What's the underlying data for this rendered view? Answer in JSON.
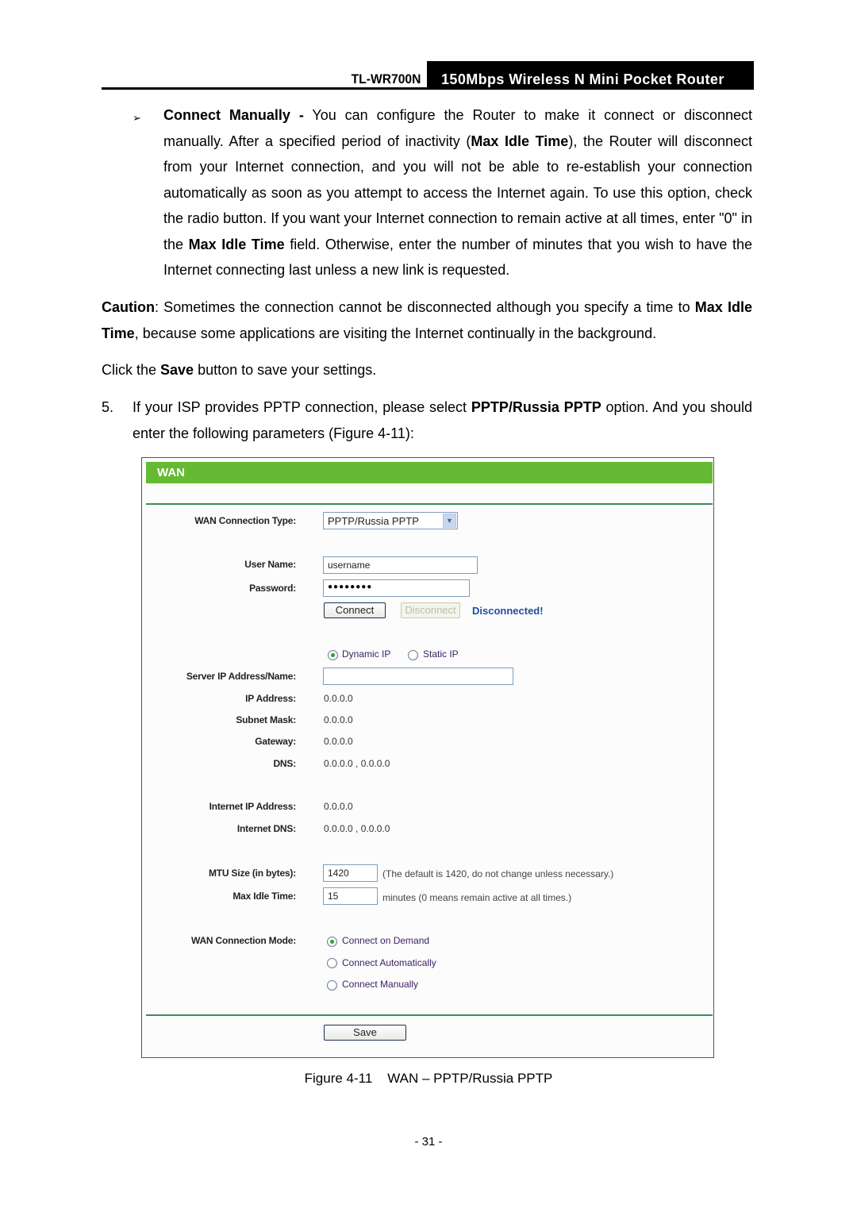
{
  "header": {
    "model": "TL-WR700N",
    "product": "150Mbps  Wireless  N  Mini  Pocket  Router"
  },
  "body": {
    "bullet_glyph": "➢",
    "p1": {
      "bold_lead": "Connect Manually -",
      "t1": " You can configure the Router to make it connect or disconnect manually. After a specified period of inactivity (",
      "b1": "Max Idle Time",
      "t2": "), the Router will disconnect from your Internet connection, and you will not be able to re-establish your connection automatically as soon as you attempt to access the Internet again. To use this option, check the radio button. If you want your Internet connection to remain active at all times, enter \"0\" in the ",
      "b2": "Max Idle Time",
      "t3": " field. Otherwise, enter the number of minutes that you wish to have the Internet connecting last unless a new link is requested."
    },
    "p2": {
      "b1": "Caution",
      "t1": ": Sometimes the connection cannot be disconnected although you specify a time to ",
      "b2": "Max Idle Time",
      "t2": ", because some applications are visiting the Internet continually in the background."
    },
    "p3": {
      "t1": "Click the ",
      "b1": "Save",
      "t2": " button to save your settings."
    },
    "p4": {
      "num": "5.",
      "t1": "If your ISP provides PPTP connection, please select ",
      "b1": "PPTP/Russia PPTP",
      "t2": " option. And you should enter the following parameters (Figure 4-11):"
    }
  },
  "figure": {
    "title": "WAN",
    "accent_color": "#66b933",
    "wan_type_label": "WAN Connection Type:",
    "wan_type_value": "PPTP/Russia PPTP",
    "username_label": "User Name:",
    "username_value": "username",
    "password_label": "Password:",
    "password_value": "●●●●●●●●",
    "connect_label": "Connect",
    "disconnect_label": "Disconnect",
    "status": "Disconnected!",
    "ip_mode_options": [
      {
        "label": "Dynamic IP",
        "selected": true
      },
      {
        "label": "Static IP",
        "selected": false
      }
    ],
    "server_label": "Server IP Address/Name:",
    "server_value": "",
    "ip_label": "IP Address:",
    "ip_value": "0.0.0.0",
    "mask_label": "Subnet Mask:",
    "mask_value": "0.0.0.0",
    "gateway_label": "Gateway:",
    "gateway_value": "0.0.0.0",
    "dns_label": "DNS:",
    "dns_value": "0.0.0.0 , 0.0.0.0",
    "inet_ip_label": "Internet IP Address:",
    "inet_ip_value": "0.0.0.0",
    "inet_dns_label": "Internet DNS:",
    "inet_dns_value": "0.0.0.0 , 0.0.0.0",
    "mtu_label": "MTU Size (in bytes):",
    "mtu_value": "1420",
    "mtu_hint": "(The default is 1420, do not change unless necessary.)",
    "idle_label": "Max Idle Time:",
    "idle_value": "15",
    "idle_hint": "minutes (0 means remain active at all times.)",
    "mode_label": "WAN Connection Mode:",
    "mode_options": [
      {
        "label": "Connect on Demand",
        "selected": true
      },
      {
        "label": "Connect Automatically",
        "selected": false
      },
      {
        "label": "Connect Manually",
        "selected": false
      }
    ],
    "save_label": "Save"
  },
  "caption": "Figure 4-11    WAN – PPTP/Russia PPTP",
  "page_number": "- 31 -"
}
